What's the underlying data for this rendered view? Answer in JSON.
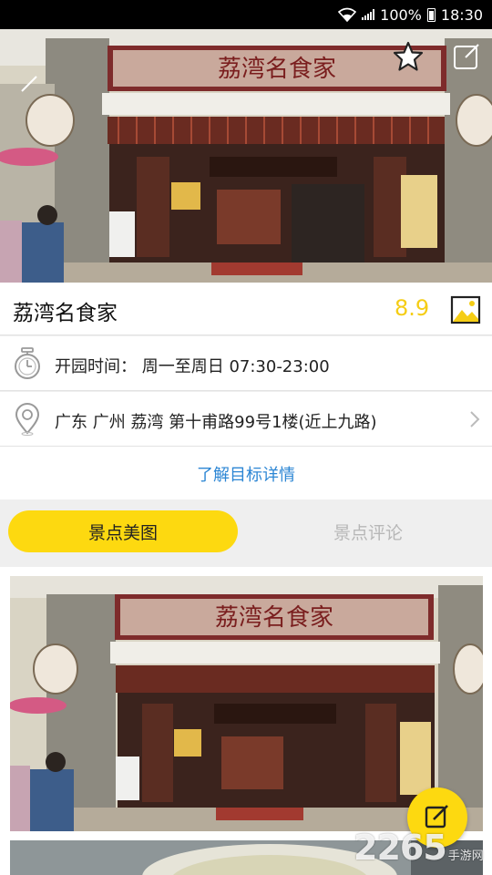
{
  "status_bar": {
    "battery": "100%",
    "time": "18:30",
    "icons": [
      "wifi-icon",
      "signal-icon",
      "battery-icon"
    ]
  },
  "hero": {
    "sign_text": "荔湾名食家",
    "actions": [
      "share-icon",
      "favorite-star-icon",
      "edit-square-icon"
    ]
  },
  "place": {
    "name": "荔湾名食家",
    "score": "8.9",
    "gallery_icon": "image-gallery-icon"
  },
  "hours": {
    "icon": "clock-icon",
    "text": "开园时间： 周一至周日 07:30-23:00"
  },
  "address": {
    "icon": "location-pin-icon",
    "text": "广东  广州  荔湾  第十甫路99号1楼(近上九路)"
  },
  "details_link": "了解目标详情",
  "tabs": [
    {
      "label": "景点美图",
      "active": true
    },
    {
      "label": "景点评论",
      "active": false
    }
  ],
  "fab_icon": "write-comment-icon",
  "watermark": {
    "number": "2265",
    "text": "手游网"
  },
  "colors": {
    "accent": "#fdd910",
    "score": "#f5cd15",
    "link": "#2c86d4"
  }
}
